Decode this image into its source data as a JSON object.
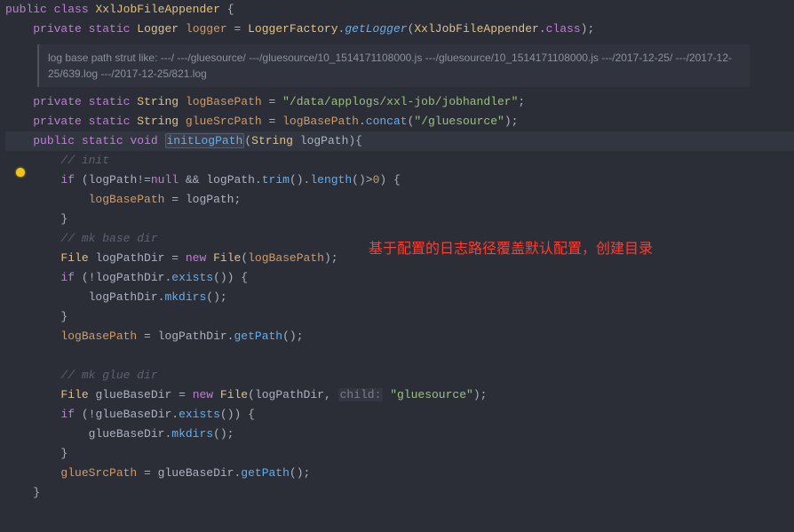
{
  "code": {
    "line1": {
      "kw1": "public",
      "kw2": "class",
      "cls": "XxlJobFileAppender",
      "brace": " {"
    },
    "line2": {
      "kw1": "private",
      "kw2": "static",
      "type": "Logger",
      "field": "logger",
      "eq": " = ",
      "type2": "LoggerFactory",
      "dot": ".",
      "method": "getLogger",
      "open": "(",
      "arg": "XxlJobFileAppender",
      "dot2": ".",
      "classkw": "class",
      "close": ");"
    },
    "doc": "log base path strut like: ---/ ---/gluesource/ ---/gluesource/10_1514171108000.js ---/gluesource/10_1514171108000.js ---/2017-12-25/ ---/2017-12-25/639.log ---/2017-12-25/821.log",
    "line3": {
      "kw1": "private",
      "kw2": "static",
      "type": "String",
      "field": "logBasePath",
      "eq": " = ",
      "str": "\"/data/applogs/xxl-job/jobhandler\"",
      "semi": ";"
    },
    "line4": {
      "kw1": "private",
      "kw2": "static",
      "type": "String",
      "field": "glueSrcPath",
      "eq": " = ",
      "field2": "logBasePath",
      "dot": ".",
      "method": "concat",
      "open": "(",
      "str": "\"/gluesource\"",
      "close": ");"
    },
    "line5": {
      "kw1": "public",
      "kw2": "static",
      "kw3": "void",
      "method": "initLogPath",
      "open": "(",
      "ptype": "String",
      "pname": "logPath",
      "close": "){"
    },
    "line6": {
      "cmt": "// init"
    },
    "line7": {
      "kw": "if",
      "open": " (",
      "v1": "logPath",
      "neq": "!=",
      "null": "null",
      "amp": " && ",
      "v2": "logPath",
      "dot": ".",
      "m1": "trim",
      "p1": "().",
      "m2": "length",
      "p2": "()>",
      "num": "0",
      "close": ") {"
    },
    "line8": {
      "field": "logBasePath",
      "eq": " = ",
      "var": "logPath",
      "semi": ";"
    },
    "line9": {
      "brace": "}"
    },
    "line10": {
      "cmt": "// mk base dir"
    },
    "line11": {
      "type": "File",
      "var": "logPathDir",
      "eq": " = ",
      "kw": "new",
      "type2": "File",
      "open": "(",
      "arg": "logBasePath",
      "close": ");"
    },
    "line12": {
      "kw": "if",
      "open": " (!",
      "var": "logPathDir",
      "dot": ".",
      "m": "exists",
      "close": "()) {"
    },
    "line13": {
      "var": "logPathDir",
      "dot": ".",
      "m": "mkdirs",
      "close": "();"
    },
    "line14": {
      "brace": "}"
    },
    "line15": {
      "field": "logBasePath",
      "eq": " = ",
      "var": "logPathDir",
      "dot": ".",
      "m": "getPath",
      "close": "();"
    },
    "line16": {
      "cmt": "// mk glue dir"
    },
    "line17": {
      "type": "File",
      "var": "glueBaseDir",
      "eq": " = ",
      "kw": "new",
      "type2": "File",
      "open": "(",
      "arg1": "logPathDir",
      "comma": ", ",
      "hint": "child:",
      "sp": " ",
      "str": "\"gluesource\"",
      "close": ");"
    },
    "line18": {
      "kw": "if",
      "open": " (!",
      "var": "glueBaseDir",
      "dot": ".",
      "m": "exists",
      "close": "()) {"
    },
    "line19": {
      "var": "glueBaseDir",
      "dot": ".",
      "m": "mkdirs",
      "close": "();"
    },
    "line20": {
      "brace": "}"
    },
    "line21": {
      "field": "glueSrcPath",
      "eq": " = ",
      "var": "glueBaseDir",
      "dot": ".",
      "m": "getPath",
      "close": "();"
    },
    "line22": {
      "brace": "}"
    }
  },
  "annotation": "基于配置的日志路径覆盖默认配置，创建目录"
}
